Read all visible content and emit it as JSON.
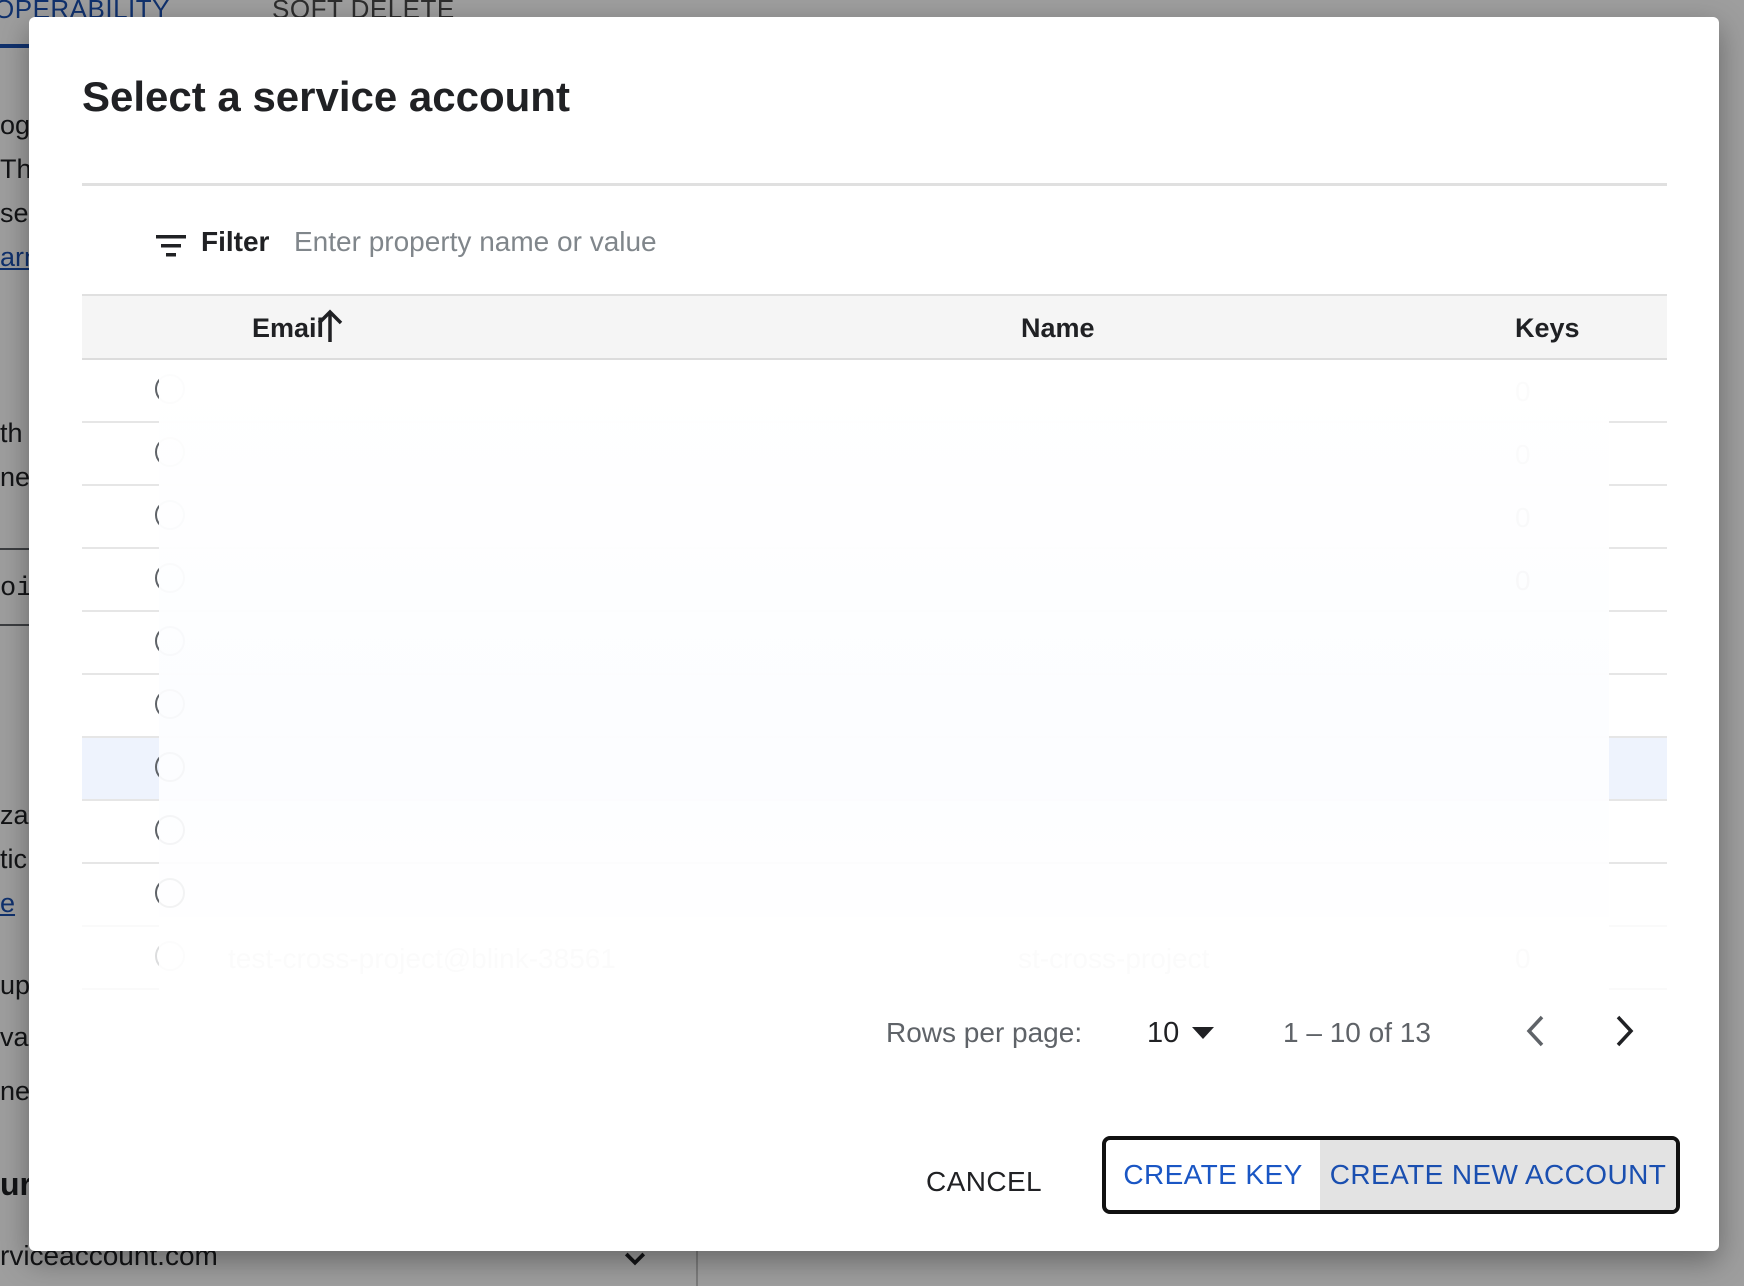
{
  "background_page": {
    "tabs": [
      "OPERABILITY",
      "SOFT DELETE"
    ],
    "side_fragments": [
      "og",
      "Thi",
      "se",
      "arn",
      "th",
      "ne",
      "ois",
      "zat",
      "tic",
      "e",
      "up",
      "va",
      "ne",
      "ur"
    ],
    "bottom_field_value": "rviceaccount.com"
  },
  "dialog": {
    "title": "Select a service account",
    "filter": {
      "label": "Filter",
      "placeholder": "Enter property name or value"
    },
    "columns": {
      "email": "Email",
      "name": "Name",
      "keys": "Keys"
    },
    "rows": [
      {
        "email": "",
        "name": "",
        "keys": "0"
      },
      {
        "email": "",
        "name": "",
        "keys": "0"
      },
      {
        "email": "",
        "name": "",
        "keys": "0"
      },
      {
        "email": "",
        "name": "",
        "keys": "0"
      },
      {
        "email": "",
        "name": "",
        "keys": ""
      },
      {
        "email": "",
        "name": "",
        "keys": ""
      },
      {
        "email": "",
        "name": "",
        "keys": ""
      },
      {
        "email": "",
        "name": "",
        "keys": ""
      },
      {
        "email": "",
        "name": "",
        "keys": ""
      },
      {
        "email": "test-cross-project@blink-38561",
        "name": "st-cross-project",
        "keys": "0"
      }
    ],
    "pagination": {
      "rows_per_page_label": "Rows per page:",
      "rows_per_page_value": "10",
      "range": "1 – 10 of 13"
    },
    "buttons": {
      "cancel": "CANCEL",
      "create_key": "CREATE KEY",
      "create_new_account": "CREATE NEW ACCOUNT"
    }
  },
  "colors": {
    "accent": "#1a56c4",
    "row_highlight": "#eef3fd",
    "header_bg": "#f5f5f5"
  },
  "icons": {
    "filter": "filter-lines-icon",
    "sort": "arrow-up-icon",
    "dropdown": "triangle-down-icon",
    "prev": "chevron-left-icon",
    "next": "chevron-right-icon"
  }
}
